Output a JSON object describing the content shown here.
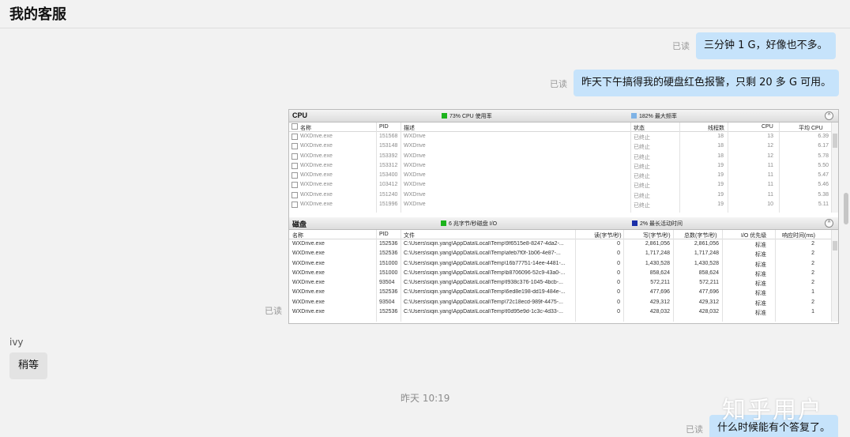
{
  "header": {
    "title": "我的客服"
  },
  "messages": {
    "m1": {
      "text": "三分钟 1 G，好像也不多。",
      "read": "已读"
    },
    "m2": {
      "text": "昨天下午搞得我的硬盘红色报警，只剩 20 多 G 可用。",
      "read": "已读"
    },
    "m3_read": "已读",
    "left_sender": "ivy",
    "left_text": "稍等",
    "timestamp": "昨天 10:19",
    "m4": {
      "text": "什么时候能有个答复了。",
      "read": "已读"
    },
    "watermark": "知乎用户"
  },
  "screenshot": {
    "cpu": {
      "title": "CPU",
      "stat1": "73% CPU 使用率",
      "stat1_color": "#1db31d",
      "stat2": "182% 最大频率",
      "stat2_color": "#7fb3e6",
      "collapse": "^",
      "columns": {
        "name": "名称",
        "pid": "PID",
        "desc": "描述",
        "status": "状态",
        "threads": "线程数",
        "cpu": "CPU",
        "avg": "平均 CPU"
      },
      "rows": [
        {
          "name": "WXDrive.exe",
          "pid": "151568",
          "desc": "WXDrive",
          "status": "已终止",
          "threads": "18",
          "cpu": "13",
          "avg": "6.39"
        },
        {
          "name": "WXDrive.exe",
          "pid": "153148",
          "desc": "WXDrive",
          "status": "已终止",
          "threads": "18",
          "cpu": "12",
          "avg": "6.17"
        },
        {
          "name": "WXDrive.exe",
          "pid": "153392",
          "desc": "WXDrive",
          "status": "已终止",
          "threads": "18",
          "cpu": "12",
          "avg": "5.78"
        },
        {
          "name": "WXDrive.exe",
          "pid": "153312",
          "desc": "WXDrive",
          "status": "已终止",
          "threads": "19",
          "cpu": "11",
          "avg": "5.50"
        },
        {
          "name": "WXDrive.exe",
          "pid": "153400",
          "desc": "WXDrive",
          "status": "已终止",
          "threads": "19",
          "cpu": "11",
          "avg": "5.47"
        },
        {
          "name": "WXDrive.exe",
          "pid": "103412",
          "desc": "WXDrive",
          "status": "已终止",
          "threads": "19",
          "cpu": "11",
          "avg": "5.46"
        },
        {
          "name": "WXDrive.exe",
          "pid": "151240",
          "desc": "WXDrive",
          "status": "已终止",
          "threads": "19",
          "cpu": "11",
          "avg": "5.38"
        },
        {
          "name": "WXDrive.exe",
          "pid": "151996",
          "desc": "WXDrive",
          "status": "已终止",
          "threads": "19",
          "cpu": "10",
          "avg": "5.11"
        }
      ]
    },
    "disk": {
      "title": "磁盘",
      "stat1": "6 兆字节/秒磁盘 I/O",
      "stat1_color": "#1db31d",
      "stat2": "2% 最长活动时间",
      "stat2_color": "#1a2fa8",
      "collapse": "^",
      "columns": {
        "name": "名称",
        "pid": "PID",
        "file": "文件",
        "read": "读(字节/秒)",
        "write": "写(字节/秒)",
        "total": "总数(字节/秒)",
        "prio": "I/O 优先级",
        "resp": "响应时间(ms)"
      },
      "rows": [
        {
          "name": "WXDrive.exe",
          "pid": "152536",
          "file": "C:\\Users\\siqin.yang\\AppData\\Local\\Temp\\9f6515e8-8247-4da2-...",
          "read": "0",
          "write": "2,861,056",
          "total": "2,861,056",
          "prio": "标准",
          "resp": "2"
        },
        {
          "name": "WXDrive.exe",
          "pid": "152536",
          "file": "C:\\Users\\siqin.yang\\AppData\\Local\\Temp\\afeb7f0f-1b06-4e87-...",
          "read": "0",
          "write": "1,717,248",
          "total": "1,717,248",
          "prio": "标准",
          "resp": "2"
        },
        {
          "name": "WXDrive.exe",
          "pid": "151000",
          "file": "C:\\Users\\siqin.yang\\AppData\\Local\\Temp\\16b77751-14ee-4481-...",
          "read": "0",
          "write": "1,430,528",
          "total": "1,430,528",
          "prio": "标准",
          "resp": "2"
        },
        {
          "name": "WXDrive.exe",
          "pid": "151000",
          "file": "C:\\Users\\siqin.yang\\AppData\\Local\\Temp\\b8706096-52c9-43a0-...",
          "read": "0",
          "write": "858,624",
          "total": "858,624",
          "prio": "标准",
          "resp": "2"
        },
        {
          "name": "WXDrive.exe",
          "pid": "93504",
          "file": "C:\\Users\\siqin.yang\\AppData\\Local\\Temp\\f938c376-1045-4bcb-...",
          "read": "0",
          "write": "572,211",
          "total": "572,211",
          "prio": "标准",
          "resp": "2"
        },
        {
          "name": "WXDrive.exe",
          "pid": "152536",
          "file": "C:\\Users\\siqin.yang\\AppData\\Local\\Temp\\6ed8e198-dd19-484e-...",
          "read": "0",
          "write": "477,696",
          "total": "477,696",
          "prio": "标准",
          "resp": "1"
        },
        {
          "name": "WXDrive.exe",
          "pid": "93504",
          "file": "C:\\Users\\siqin.yang\\AppData\\Local\\Temp\\72c18ecd-989f-4475-...",
          "read": "0",
          "write": "429,312",
          "total": "429,312",
          "prio": "标准",
          "resp": "2"
        },
        {
          "name": "WXDrive.exe",
          "pid": "152536",
          "file": "C:\\Users\\siqin.yang\\AppData\\Local\\Temp\\f0d95e9d-1c3c-4d33-...",
          "read": "0",
          "write": "428,032",
          "total": "428,032",
          "prio": "标准",
          "resp": "1"
        }
      ]
    }
  }
}
